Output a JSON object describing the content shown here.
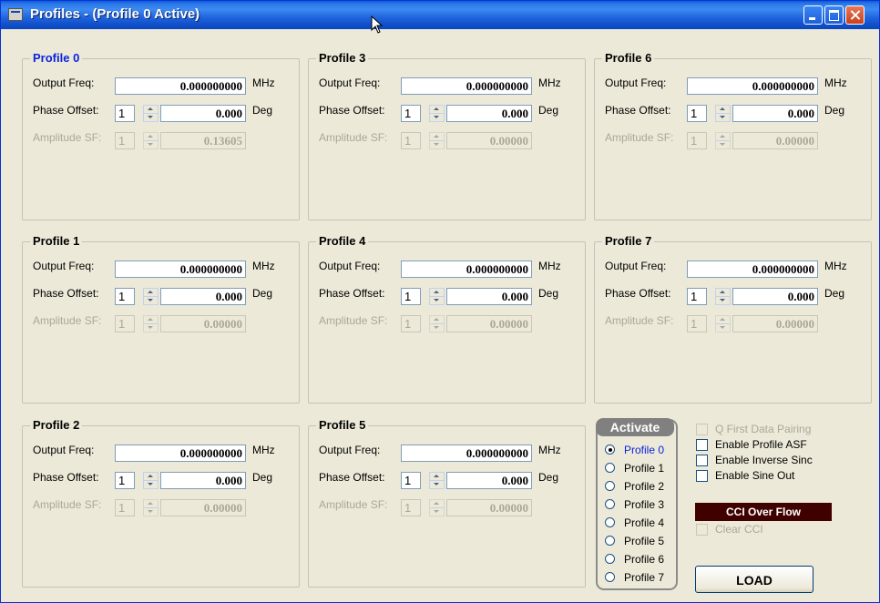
{
  "window": {
    "title": "Profiles - (Profile 0 Active)"
  },
  "common": {
    "freq_label": "Output Freq:",
    "phase_label": "Phase Offset:",
    "amp_label": "Amplitude SF:",
    "freq_unit": "MHz",
    "phase_unit": "Deg"
  },
  "profiles": [
    {
      "title": "Profile 0",
      "freq": "0.000000000",
      "phase_step": "1",
      "phase": "0.000",
      "amp_step": "1",
      "amp": "0.13605"
    },
    {
      "title": "Profile 1",
      "freq": "0.000000000",
      "phase_step": "1",
      "phase": "0.000",
      "amp_step": "1",
      "amp": "0.00000"
    },
    {
      "title": "Profile 2",
      "freq": "0.000000000",
      "phase_step": "1",
      "phase": "0.000",
      "amp_step": "1",
      "amp": "0.00000"
    },
    {
      "title": "Profile 3",
      "freq": "0.000000000",
      "phase_step": "1",
      "phase": "0.000",
      "amp_step": "1",
      "amp": "0.00000"
    },
    {
      "title": "Profile 4",
      "freq": "0.000000000",
      "phase_step": "1",
      "phase": "0.000",
      "amp_step": "1",
      "amp": "0.00000"
    },
    {
      "title": "Profile 5",
      "freq": "0.000000000",
      "phase_step": "1",
      "phase": "0.000",
      "amp_step": "1",
      "amp": "0.00000"
    },
    {
      "title": "Profile 6",
      "freq": "0.000000000",
      "phase_step": "1",
      "phase": "0.000",
      "amp_step": "1",
      "amp": "0.00000"
    },
    {
      "title": "Profile 7",
      "freq": "0.000000000",
      "phase_step": "1",
      "phase": "0.000",
      "amp_step": "1",
      "amp": "0.00000"
    }
  ],
  "activate": {
    "title": "Activate",
    "options": [
      "Profile 0",
      "Profile 1",
      "Profile 2",
      "Profile 3",
      "Profile 4",
      "Profile 5",
      "Profile 6",
      "Profile 7"
    ],
    "selected": "Profile 0"
  },
  "options": {
    "q_first": "Q First Data Pairing",
    "profile_asf": "Enable Profile ASF",
    "inverse_sinc": "Enable Inverse Sinc",
    "sine_out": "Enable Sine Out"
  },
  "cci": {
    "banner": "CCI Over Flow",
    "clear": "Clear CCI"
  },
  "load_label": "LOAD",
  "colors": {
    "active_title": "#0a24dd",
    "cci_banner": "#400000",
    "titlebar": "#0b47bb",
    "window_bg": "#ece9d8"
  }
}
